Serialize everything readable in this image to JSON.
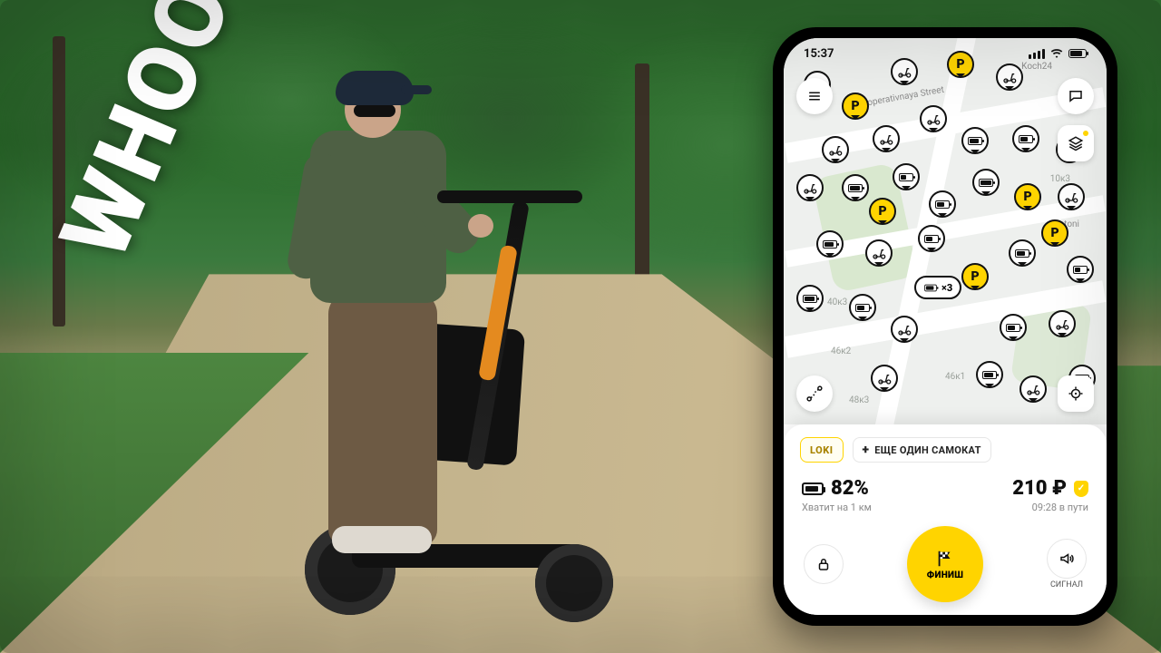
{
  "brand_text": "WHOOSH",
  "statusbar": {
    "time": "15:37"
  },
  "map": {
    "streets": {
      "kooperativnaya": "Kooperativnaya Street",
      "koch24": "Koch24",
      "batoni": "Batoni"
    },
    "house_numbers": {
      "h40k3": "40к3",
      "h46k2": "46к2",
      "h46k1": "46к1",
      "h10k3": "10к3",
      "h48k3": "48к3"
    },
    "cluster_count": "×3"
  },
  "sheet": {
    "tab_active": "LOKI",
    "tab_add": "ЕЩЕ ОДИН САМОКАТ",
    "battery_pct": "82%",
    "battery_sub": "Хватит на 1 км",
    "price": "210 ₽",
    "trip_sub": "09:28 в пути",
    "finish_label": "ФИНИШ",
    "signal_label": "СИГНАЛ"
  }
}
